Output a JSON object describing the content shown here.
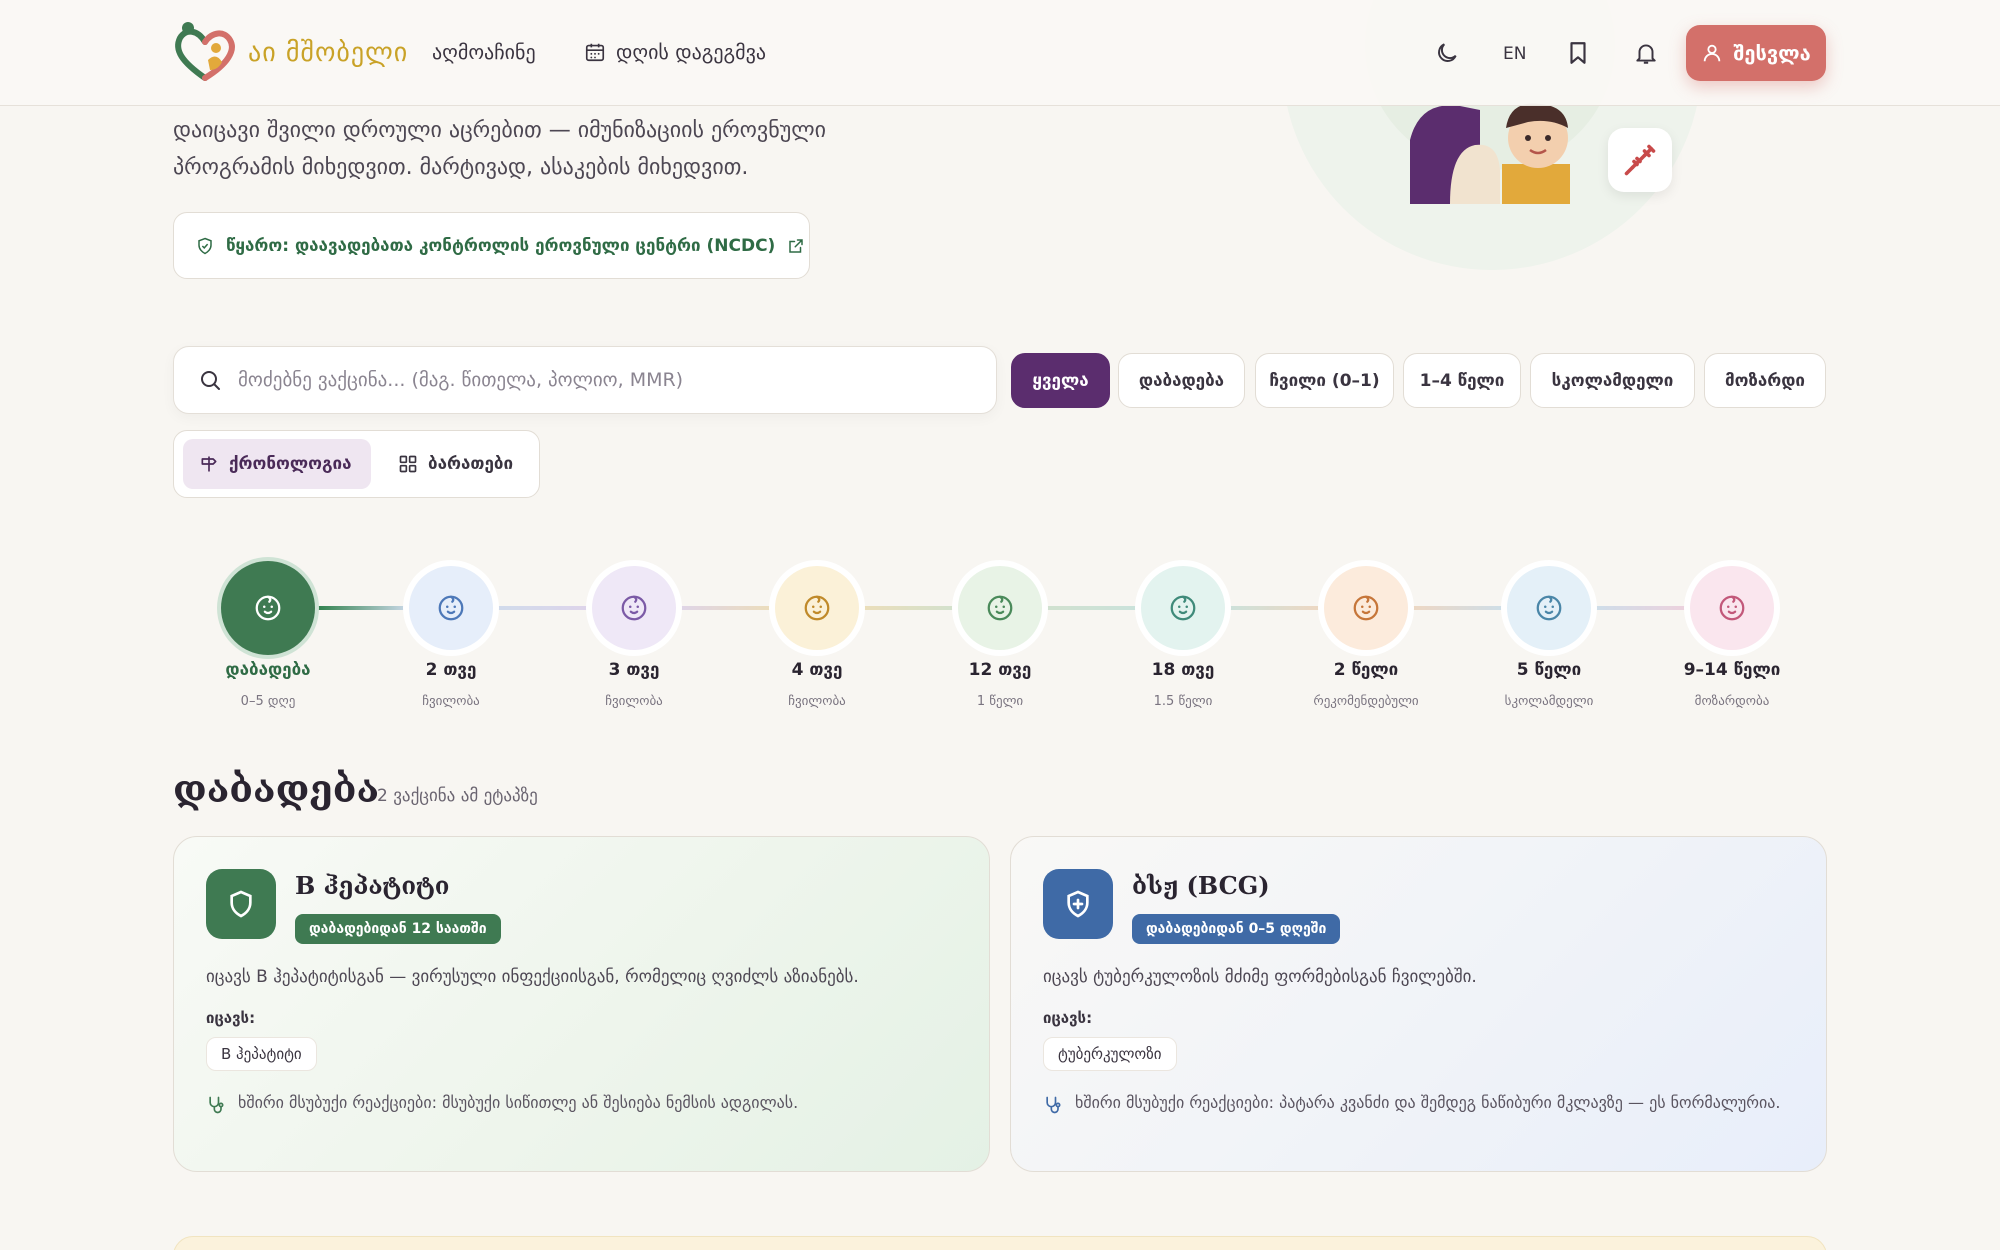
{
  "header": {
    "logo_text": "აი მშობელი",
    "nav_explore": "აღმოაჩინე",
    "nav_plan": "დღის დაგეგმვა",
    "lang": "EN",
    "login_label": "შესვლა"
  },
  "hero": {
    "description": "დაიცავი შვილი დროული აცრებით — იმუნიზაციის ეროვნული პროგრამის მიხედვით. მარტივად, ასაკების მიხედვით.",
    "source_label": "წყარო: დაავადებათა კონტროლის ეროვნული ცენტრი (NCDC)"
  },
  "search": {
    "placeholder": "მოძებნე ვაქცინა... (მაგ. წითელა, პოლიო, MMR)"
  },
  "filters": [
    "ყველა",
    "დაბადება",
    "ჩვილი (0–1)",
    "1–4 წელი",
    "სკოლამდელი",
    "მოზარდი"
  ],
  "filters_active": 0,
  "view_toggle": {
    "timeline_label": "ქრონოლოგია",
    "cards_label": "ბარათები"
  },
  "timeline": [
    {
      "label": "დაბადება",
      "sub": "0–5 დღე",
      "color": "#3f7a52",
      "bg": "#3f7a52"
    },
    {
      "label": "2 თვე",
      "sub": "ჩვილობა",
      "color": "#4d78b8",
      "bg": "#e6eefa"
    },
    {
      "label": "3 თვე",
      "sub": "ჩვილობა",
      "color": "#7b5aa6",
      "bg": "#efe8f7"
    },
    {
      "label": "4 თვე",
      "sub": "ჩვილობა",
      "color": "#c08a2a",
      "bg": "#fbf1d8"
    },
    {
      "label": "12 თვე",
      "sub": "1 წელი",
      "color": "#4a8a5a",
      "bg": "#e8f3e6"
    },
    {
      "label": "18 თვე",
      "sub": "1.5 წელი",
      "color": "#3f8a7a",
      "bg": "#e3f3ef"
    },
    {
      "label": "2 წელი",
      "sub": "რეკომენდებული",
      "color": "#c6763a",
      "bg": "#fcebdc"
    },
    {
      "label": "5 წელი",
      "sub": "სკოლამდელი",
      "color": "#4a86a8",
      "bg": "#e4f0f8"
    },
    {
      "label": "9–14 წელი",
      "sub": "მოზარდობა",
      "color": "#c2587a",
      "bg": "#fae6ee"
    }
  ],
  "section": {
    "title": "დაბადება",
    "count": "2 ვაქცინა ამ ეტაპზე"
  },
  "cards": [
    {
      "title": "B ჰეპატიტი",
      "badge": "დაბადებიდან 12 საათში",
      "description": "იცავს B ჰეპატიტისგან — ვირუსული ინფექციისგან, რომელიც ღვიძლს აზიანებს.",
      "protects_label": "იცავს:",
      "protects_tag": "B ჰეპატიტი",
      "reactions": "ხშირი მსუბუქი რეაქციები: მსუბუქი სიწითლე ან შესიება ნემსის ადგილას.",
      "accent": "#3f7a52"
    },
    {
      "title": "ბსჟ (BCG)",
      "badge": "დაბადებიდან 0–5 დღეში",
      "description": "იცავს ტუბერკულოზის მძიმე ფორმებისგან ჩვილებში.",
      "protects_label": "იცავს:",
      "protects_tag": "ტუბერკულოზი",
      "reactions": "ხშირი მსუბუქი რეაქციები: პატარა კვანძი და შემდეგ ნაწიბური მკლავზე — ეს ნორმალურია.",
      "accent": "#3f6aa6"
    }
  ]
}
